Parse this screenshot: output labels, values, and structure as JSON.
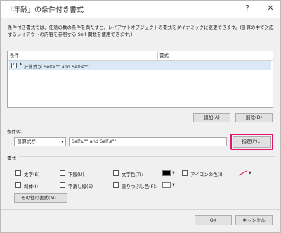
{
  "window": {
    "title": "「年齢」の条件付き書式",
    "help_glyph": "?",
    "close_glyph": "✕"
  },
  "description": {
    "line1": "条件付き書式では、任意の数の条件を満たすと、レイアウトオブジェクトの書式をダイナミックに変更できます。(計算の中で対応",
    "line2": "するレイアウトの内容を参照する Self 関数を使用できます。)"
  },
  "conditions_table": {
    "col_condition": "条件",
    "col_format": "書式",
    "rows": [
      {
        "checked": true,
        "text": "計算式が Self≥\"\" and Self≤\"\""
      }
    ]
  },
  "list_buttons": {
    "add": "追加(A)",
    "delete": "削除(D)"
  },
  "condition_section": {
    "label": "条件(C)",
    "type_select": "計算式が",
    "formula_value": "Self≥\"\" and Self≤\"\"",
    "specify_button": "指定(P)..."
  },
  "format_section": {
    "label": "書式",
    "bold": "太字(B)",
    "underline": "下線(U)",
    "text_color": "文字色(T):",
    "icon_color": "アイコンの色(I):",
    "italic": "斜体(I)",
    "strikethrough": "字消し線(S)",
    "fill_color": "塗りつぶし色(F):",
    "other_button": "その他の書式(M)..."
  },
  "footer": {
    "ok": "OK",
    "cancel": "キャンセル"
  },
  "colors": {
    "highlight": "#e0176b",
    "text_color_swatch": "#000000",
    "fill_color_swatch": "#ffffff",
    "icon_color_stroke": "#e0176b"
  },
  "icons": {
    "row_checkbox": "checkbox-checked",
    "row_sort": "sort-updown-icon",
    "dropdown": "chevron-down-icon",
    "icon_color_pen": "pen-icon"
  }
}
